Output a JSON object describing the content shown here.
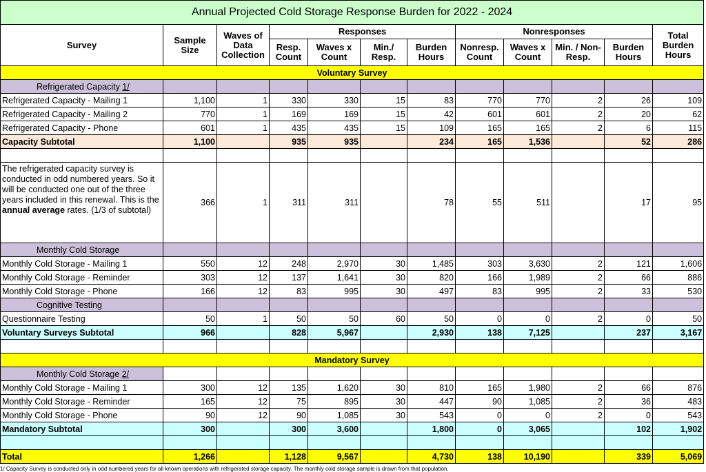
{
  "title": "Annual Projected Cold Storage Response Burden for 2022 - 2024",
  "headers": {
    "survey": "Survey",
    "sample_size": "Sample Size",
    "waves": "Waves of Data Collection",
    "responses": "Responses",
    "nonresponses": "Nonresponses",
    "total_burden": "Total Burden Hours",
    "resp_count": "Resp. Count",
    "waves_x_count": "Waves x Count",
    "min_resp": "Min./ Resp.",
    "burden_hours": "Burden Hours",
    "nonresp_count": "Nonresp. Count",
    "waves_x_count_2": "Waves x Count",
    "min_nonresp": "Min. / Non-Resp.",
    "burden_hours_2": "Burden Hours"
  },
  "voluntary_label": "Voluntary Survey",
  "mandatory_label": "Mandatory Survey",
  "groups": {
    "refrigerated_capacity": "Refrigerated Capacity ",
    "refrigerated_capacity_ref": "1/",
    "monthly_cold_storage": "Monthly Cold Storage",
    "cognitive_testing": "Cognitive Testing",
    "monthly_cold_storage_mand": "Monthly Cold Storage ",
    "monthly_cold_storage_mand_ref": "2/"
  },
  "capacity_rows": [
    {
      "name": "Refrigerated Capacity - Mailing 1",
      "sample": "1,100",
      "waves": "1",
      "resp": "330",
      "wxc": "330",
      "min": "15",
      "bh": "83",
      "nonresp": "770",
      "nwxc": "770",
      "nmin": "2",
      "nbh": "26",
      "total": "109"
    },
    {
      "name": "Refrigerated Capacity - Mailing 2",
      "sample": "770",
      "waves": "1",
      "resp": "169",
      "wxc": "169",
      "min": "15",
      "bh": "42",
      "nonresp": "601",
      "nwxc": "601",
      "nmin": "2",
      "nbh": "20",
      "total": "62"
    },
    {
      "name": "Refrigerated Capacity - Phone",
      "sample": "601",
      "waves": "1",
      "resp": "435",
      "wxc": "435",
      "min": "15",
      "bh": "109",
      "nonresp": "165",
      "nwxc": "165",
      "nmin": "2",
      "nbh": "6",
      "total": "115"
    }
  ],
  "capacity_subtotal": {
    "name": "Capacity Subtotal",
    "sample": "1,100",
    "waves": "",
    "resp": "935",
    "wxc": "935",
    "min": "",
    "bh": "234",
    "nonresp": "165",
    "nwxc": "1,536",
    "nmin": "",
    "nbh": "52",
    "total": "286"
  },
  "note_row": {
    "text_1": "The refrigerated capacity survey is conducted in odd numbered years. So it will be conducted one out of the three years included in this renewal. This is the ",
    "text_bold": "annual average",
    "text_2": " rates. (1/3 of subtotal)",
    "sample": "366",
    "waves": "1",
    "resp": "311",
    "wxc": "311",
    "min": "",
    "bh": "78",
    "nonresp": "55",
    "nwxc": "511",
    "nmin": "",
    "nbh": "17",
    "total": "95"
  },
  "monthly_rows": [
    {
      "name": "Monthly Cold Storage - Mailing 1",
      "sample": "550",
      "waves": "12",
      "resp": "248",
      "wxc": "2,970",
      "min": "30",
      "bh": "1,485",
      "nonresp": "303",
      "nwxc": "3,630",
      "nmin": "2",
      "nbh": "121",
      "total": "1,606"
    },
    {
      "name": "Monthly Cold Storage - Reminder",
      "sample": "303",
      "waves": "12",
      "resp": "137",
      "wxc": "1,641",
      "min": "30",
      "bh": "820",
      "nonresp": "166",
      "nwxc": "1,989",
      "nmin": "2",
      "nbh": "66",
      "total": "886"
    },
    {
      "name": "Monthly Cold Storage - Phone",
      "sample": "166",
      "waves": "12",
      "resp": "83",
      "wxc": "995",
      "min": "30",
      "bh": "497",
      "nonresp": "83",
      "nwxc": "995",
      "nmin": "2",
      "nbh": "33",
      "total": "530"
    }
  ],
  "cognitive_rows": [
    {
      "name": "Questionnaire Testing",
      "sample": "50",
      "waves": "1",
      "resp": "50",
      "wxc": "50",
      "min": "60",
      "bh": "50",
      "nonresp": "0",
      "nwxc": "0",
      "nmin": "2",
      "nbh": "0",
      "total": "50"
    }
  ],
  "voluntary_subtotal": {
    "name": "Voluntary Surveys Subtotal",
    "sample": "966",
    "waves": "",
    "resp": "828",
    "wxc": "5,967",
    "min": "",
    "bh": "2,930",
    "nonresp": "138",
    "nwxc": "7,125",
    "nmin": "",
    "nbh": "237",
    "total": "3,167"
  },
  "mandatory_rows": [
    {
      "name": "Monthly Cold Storage - Mailing 1",
      "sample": "300",
      "waves": "12",
      "resp": "135",
      "wxc": "1,620",
      "min": "30",
      "bh": "810",
      "nonresp": "165",
      "nwxc": "1,980",
      "nmin": "2",
      "nbh": "66",
      "total": "876"
    },
    {
      "name": "Monthly Cold Storage - Reminder",
      "sample": "165",
      "waves": "12",
      "resp": "75",
      "wxc": "895",
      "min": "30",
      "bh": "447",
      "nonresp": "90",
      "nwxc": "1,085",
      "nmin": "2",
      "nbh": "36",
      "total": "483"
    },
    {
      "name": "Monthly Cold Storage - Phone",
      "sample": "90",
      "waves": "12",
      "resp": "90",
      "wxc": "1,085",
      "min": "30",
      "bh": "543",
      "nonresp": "0",
      "nwxc": "0",
      "nmin": "2",
      "nbh": "0",
      "total": "543"
    }
  ],
  "mandatory_subtotal": {
    "name": "Mandatory Subtotal",
    "sample": "300",
    "waves": "",
    "resp": "300",
    "wxc": "3,600",
    "min": "",
    "bh": "1,800",
    "nonresp": "0",
    "nwxc": "3,065",
    "nmin": "",
    "nbh": "102",
    "total": "1,902"
  },
  "grand_total": {
    "name": "Total",
    "sample": "1,266",
    "waves": "",
    "resp": "1,128",
    "wxc": "9,567",
    "min": "",
    "bh": "4,730",
    "nonresp": "138",
    "nwxc": "10,190",
    "nmin": "",
    "nbh": "339",
    "total": "5,069"
  },
  "footnote": "1/ Capacity Survey is conducted only in odd numbered years for all known operations with refrigerated storage capacity.  The monthly cold storage sample is drawn from that population."
}
